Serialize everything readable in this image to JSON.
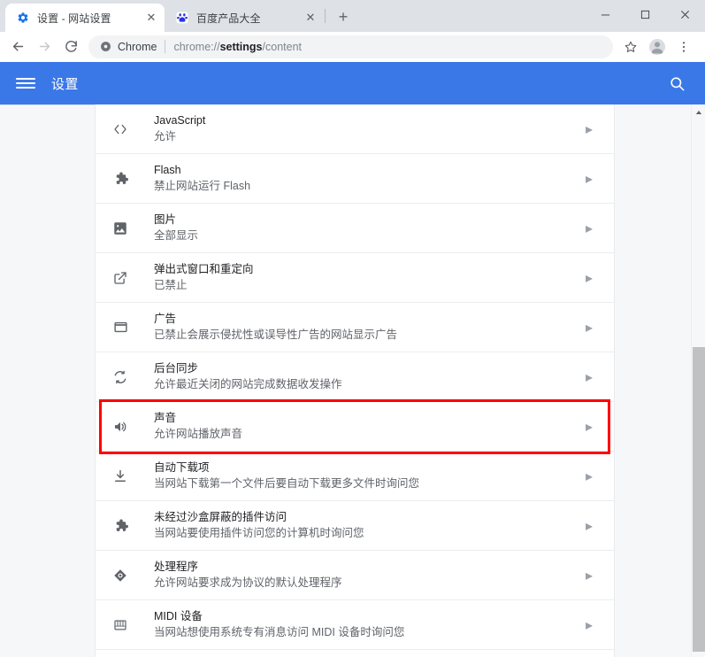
{
  "browser": {
    "tabs": [
      {
        "title": "设置 - 网站设置",
        "favicon": "gear-icon",
        "active": true,
        "close_label": "✕"
      },
      {
        "title": "百度产品大全",
        "favicon": "baidu-icon",
        "active": false,
        "close_label": "✕"
      }
    ],
    "new_tab_label": "+",
    "window_controls": {
      "minimize": "—",
      "maximize": "□",
      "close": "✕"
    },
    "toolbar": {
      "back_label": "←",
      "forward_label": "→",
      "reload_label": "⟳",
      "bookmark_label": "☆",
      "menu_label": "⋮",
      "omnibox": {
        "security_chip": "Chrome",
        "url_prefix": "chrome://",
        "url_bold": "settings",
        "url_suffix": "/content"
      }
    }
  },
  "settings_header": {
    "menu_label": "菜单",
    "title": "设置",
    "search_label": "搜索"
  },
  "content": {
    "rows": [
      {
        "icon": "code-icon",
        "title": "JavaScript",
        "subtitle": "允许",
        "highlighted": false
      },
      {
        "icon": "puzzle-icon",
        "title": "Flash",
        "subtitle": "禁止网站运行 Flash",
        "highlighted": false
      },
      {
        "icon": "image-icon",
        "title": "图片",
        "subtitle": "全部显示",
        "highlighted": false
      },
      {
        "icon": "open-in-new-icon",
        "title": "弹出式窗口和重定向",
        "subtitle": "已禁止",
        "highlighted": false
      },
      {
        "icon": "ads-window-icon",
        "title": "广告",
        "subtitle": "已禁止会展示侵扰性或误导性广告的网站显示广告",
        "highlighted": false
      },
      {
        "icon": "sync-icon",
        "title": "后台同步",
        "subtitle": "允许最近关闭的网站完成数据收发操作",
        "highlighted": false
      },
      {
        "icon": "volume-icon",
        "title": "声音",
        "subtitle": "允许网站播放声音",
        "highlighted": true
      },
      {
        "icon": "download-icon",
        "title": "自动下载项",
        "subtitle": "当网站下载第一个文件后要自动下载更多文件时询问您",
        "highlighted": false
      },
      {
        "icon": "puzzle-icon",
        "title": "未经过沙盒屏蔽的插件访问",
        "subtitle": "当网站要使用插件访问您的计算机时询问您",
        "highlighted": false
      },
      {
        "icon": "handler-icon",
        "title": "处理程序",
        "subtitle": "允许网站要求成为协议的默认处理程序",
        "highlighted": false
      },
      {
        "icon": "midi-icon",
        "title": "MIDI 设备",
        "subtitle": "当网站想使用系统专有消息访问 MIDI 设备时询问您",
        "highlighted": false
      }
    ],
    "chevron_glyph": "▸"
  },
  "colors": {
    "accent_blue": "#3b78e7",
    "highlight_red": "#fe0000",
    "tabstrip_bg": "#dee1e6",
    "page_bg": "#f6f7f9",
    "text_primary": "#202124",
    "text_secondary": "#5f6368"
  }
}
